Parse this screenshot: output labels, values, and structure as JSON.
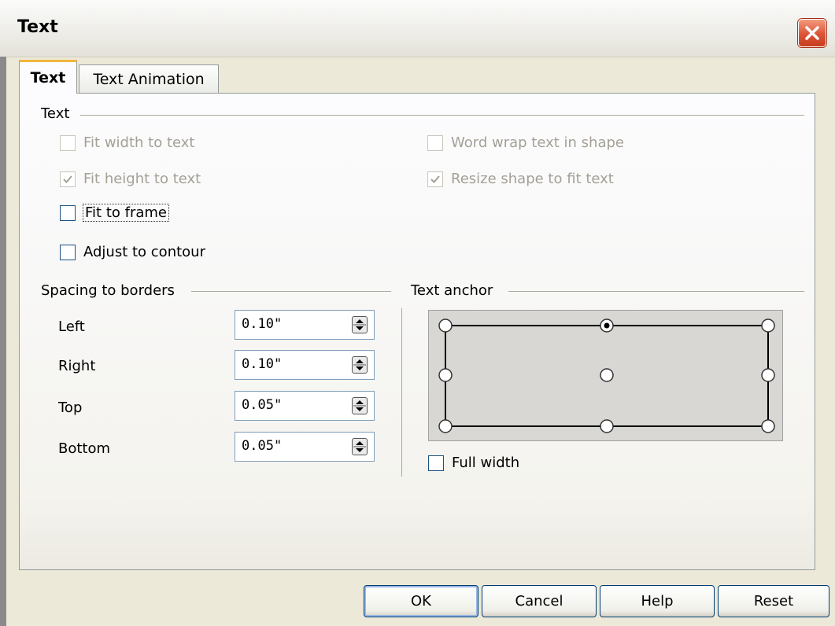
{
  "window": {
    "title": "Text"
  },
  "tabs": [
    {
      "label": "Text",
      "active": true
    },
    {
      "label": "Text Animation",
      "active": false
    }
  ],
  "text_group": {
    "label": "Text",
    "options": {
      "fit_width": {
        "label": "Fit width to text",
        "checked": false,
        "enabled": false
      },
      "word_wrap": {
        "label": "Word wrap text in shape",
        "checked": false,
        "enabled": false
      },
      "fit_height": {
        "label": "Fit height to text",
        "checked": true,
        "enabled": false
      },
      "resize_shape": {
        "label": "Resize shape to fit text",
        "checked": true,
        "enabled": false
      },
      "fit_frame": {
        "label": "Fit to frame",
        "checked": false,
        "enabled": true
      },
      "adjust_contour": {
        "label": "Adjust to contour",
        "checked": false,
        "enabled": true
      }
    }
  },
  "spacing": {
    "label": "Spacing to borders",
    "left": {
      "label": "Left",
      "value": "0.10\""
    },
    "right": {
      "label": "Right",
      "value": "0.10\""
    },
    "top": {
      "label": "Top",
      "value": "0.05\""
    },
    "bottom": {
      "label": "Bottom",
      "value": "0.05\""
    }
  },
  "anchor": {
    "label": "Text anchor",
    "selected": "top-center",
    "full_width": {
      "label": "Full width",
      "checked": false
    }
  },
  "buttons": {
    "ok": "OK",
    "cancel": "Cancel",
    "help": "Help",
    "reset": "Reset"
  },
  "colors": {
    "dialog_bg": "#ece9d8",
    "active_tab_accent": "#f2b63e",
    "close_button": "#dc5436"
  }
}
